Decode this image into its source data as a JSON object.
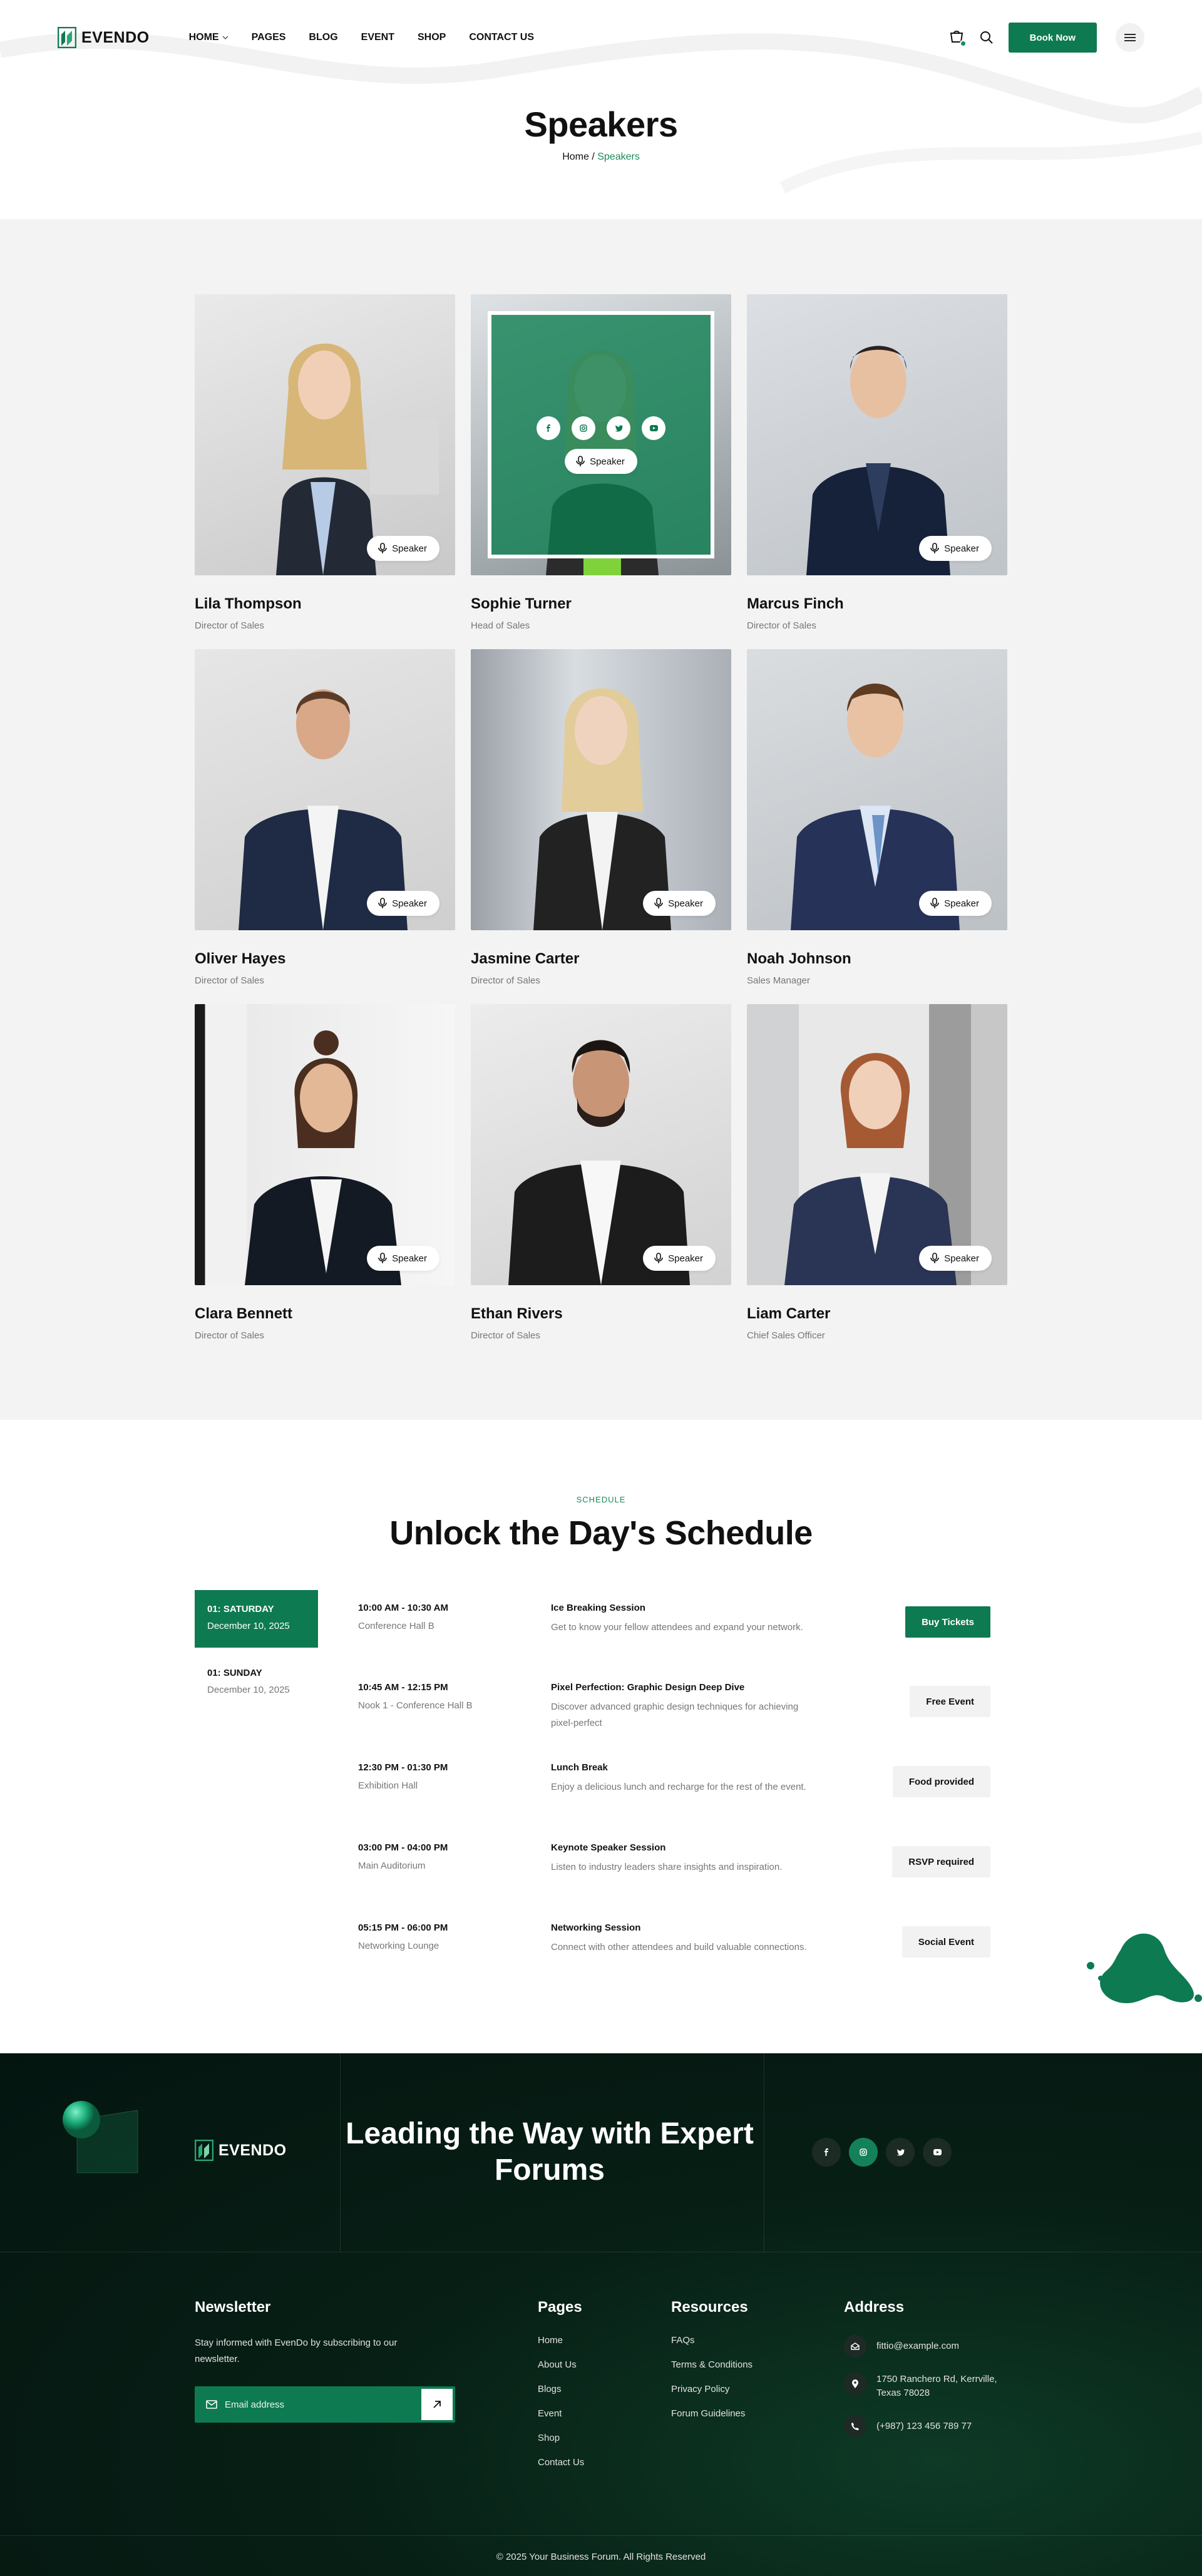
{
  "header": {
    "brand": "EVENDO",
    "nav": [
      {
        "label": "HOME",
        "has_dropdown": true
      },
      {
        "label": "PAGES"
      },
      {
        "label": "BLOG"
      },
      {
        "label": "EVENT"
      },
      {
        "label": "SHOP"
      },
      {
        "label": "CONTACT US"
      }
    ],
    "book_label": "Book Now",
    "title": "Speakers",
    "breadcrumb": {
      "home": "Home",
      "separator": " / ",
      "current": "Speakers"
    }
  },
  "speakers": [
    {
      "name": "Lila Thompson",
      "role": "Director of Sales",
      "badge": "Speaker"
    },
    {
      "name": "Sophie Turner",
      "role": "Head of Sales",
      "badge": "Speaker",
      "hovered": true
    },
    {
      "name": "Marcus Finch",
      "role": "Director of Sales",
      "badge": "Speaker"
    },
    {
      "name": "Oliver Hayes",
      "role": "Director of Sales",
      "badge": "Speaker"
    },
    {
      "name": "Jasmine Carter",
      "role": "Director of Sales",
      "badge": "Speaker"
    },
    {
      "name": "Noah Johnson",
      "role": "Sales Manager",
      "badge": "Speaker"
    },
    {
      "name": "Clara Bennett",
      "role": "Director of Sales",
      "badge": "Speaker"
    },
    {
      "name": "Ethan Rivers",
      "role": "Director of Sales",
      "badge": "Speaker"
    },
    {
      "name": "Liam Carter",
      "role": "Chief Sales Officer",
      "badge": "Speaker"
    }
  ],
  "schedule": {
    "tag": "SCHEDULE",
    "title": "Unlock the Day's Schedule",
    "days": [
      {
        "label": "01: SATURDAY",
        "date": "December 10, 2025",
        "active": true
      },
      {
        "label": "01: SUNDAY",
        "date": "December 10, 2025",
        "active": false
      }
    ],
    "sessions": [
      {
        "time": "10:00 AM - 10:30 AM",
        "location": "Conference Hall B",
        "title": "Ice Breaking Session",
        "desc": "Get to know your fellow attendees and expand your network.",
        "action": "Buy Tickets",
        "primary": true
      },
      {
        "time": "10:45 AM - 12:15 PM",
        "location": "Nook 1 - Conference Hall B",
        "title": "Pixel Perfection: Graphic Design Deep Dive",
        "desc": "Discover advanced graphic design techniques for achieving pixel-perfect",
        "action": "Free Event"
      },
      {
        "time": "12:30 PM - 01:30 PM",
        "location": "Exhibition Hall",
        "title": "Lunch Break",
        "desc": "Enjoy a delicious lunch and recharge for the rest of the event.",
        "action": "Food provided"
      },
      {
        "time": "03:00 PM - 04:00 PM",
        "location": "Main Auditorium",
        "title": "Keynote Speaker Session",
        "desc": "Listen to industry leaders share insights and inspiration.",
        "action": "RSVP required"
      },
      {
        "time": "05:15 PM - 06:00 PM",
        "location": "Networking Lounge",
        "title": "Networking Session",
        "desc": "Connect with other attendees and build valuable connections.",
        "action": "Social Event"
      }
    ]
  },
  "footer": {
    "brand": "EVENDO",
    "heading": "Leading the Way with Expert Forums",
    "newsletter": {
      "title": "Newsletter",
      "text": "Stay informed with EvenDo by subscribing to our newsletter.",
      "placeholder": "Email address"
    },
    "pages": {
      "title": "Pages",
      "links": [
        "Home",
        "About Us",
        "Blogs",
        "Event",
        "Shop",
        "Contact Us"
      ]
    },
    "resources": {
      "title": "Resources",
      "links": [
        "FAQs",
        "Terms & Conditions",
        "Privacy Policy",
        "Forum Guidelines"
      ]
    },
    "address": {
      "title": "Address",
      "email": "fittio@example.com",
      "street": "1750 Ranchero Rd, Kerrville, Texas 78028",
      "phone": "(+987) 123 456 789 77"
    },
    "copyright": "© 2025 Your Business Forum. All Rights Reserved"
  },
  "colors": {
    "brand_green": "#0e7a52",
    "footer_bg": "#071f15",
    "section_gray": "#f3f3f3"
  }
}
